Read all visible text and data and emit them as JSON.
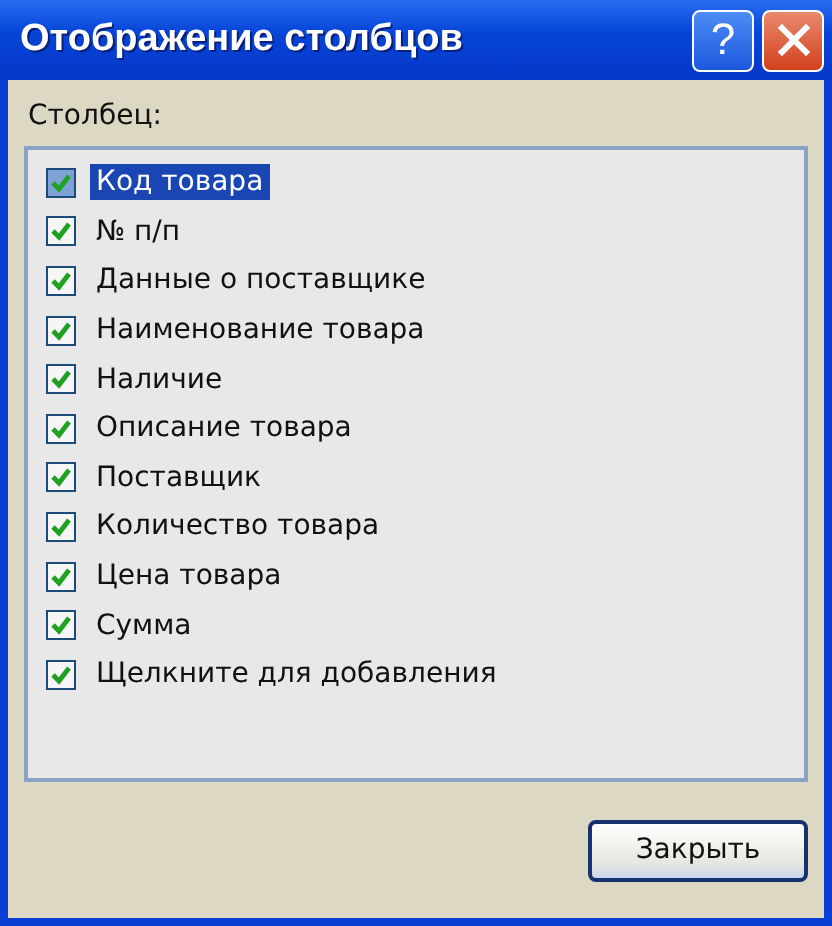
{
  "window": {
    "title": "Отображение столбцов",
    "buttons": [
      {
        "kind": "help",
        "label": "?"
      },
      {
        "kind": "close"
      }
    ]
  },
  "list_label": "Столбец:",
  "columns": [
    {
      "label": "Код товара",
      "checked": true,
      "selected": true
    },
    {
      "label": "№ п/п",
      "checked": true,
      "selected": false
    },
    {
      "label": "Данные о поставщике",
      "checked": true,
      "selected": false
    },
    {
      "label": "Наименование товара",
      "checked": true,
      "selected": false
    },
    {
      "label": "Наличие",
      "checked": true,
      "selected": false
    },
    {
      "label": "Описание товара",
      "checked": true,
      "selected": false
    },
    {
      "label": "Поставщик",
      "checked": true,
      "selected": false
    },
    {
      "label": "Количество товара",
      "checked": true,
      "selected": false
    },
    {
      "label": "Цена товара",
      "checked": true,
      "selected": false
    },
    {
      "label": "Сумма",
      "checked": true,
      "selected": false
    },
    {
      "label": "Щелкните для добавления",
      "checked": true,
      "selected": false
    }
  ],
  "buttons": [
    {
      "label": "Закрыть"
    }
  ]
}
